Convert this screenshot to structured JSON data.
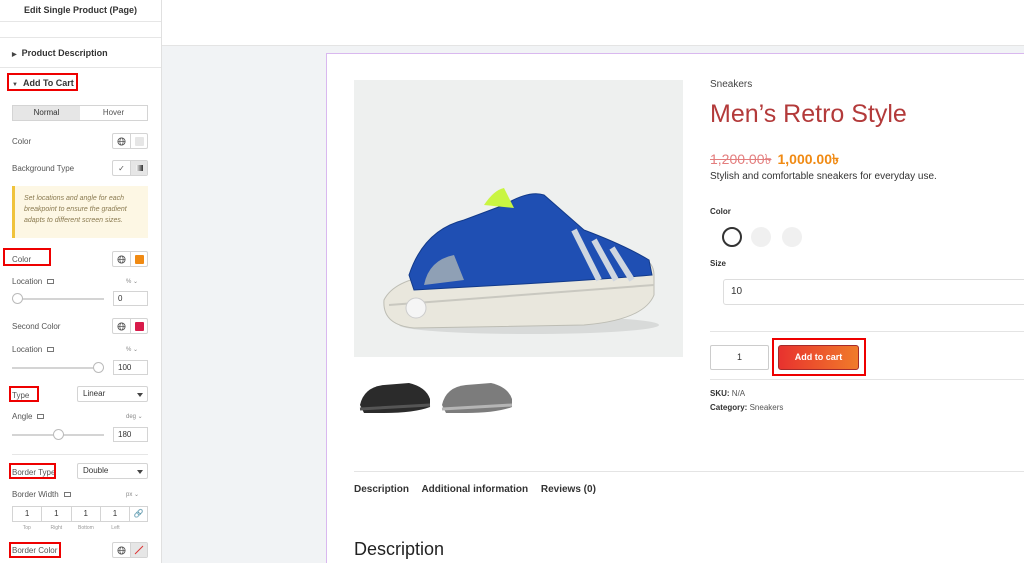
{
  "panel": {
    "title": "Edit Single Product (Page)",
    "sections": {
      "product_description": "Product Description",
      "add_to_cart": "Add To Cart"
    },
    "tabs": [
      "Normal",
      "Hover"
    ],
    "color_label": "Color",
    "background_type_label": "Background Type",
    "notice": "Set locations and angle for each breakpoint to ensure the gradient adapts to different screen sizes.",
    "gradient": {
      "color_label": "Color",
      "color_value": "#f08a13",
      "location_label": "Location",
      "location_unit": "% ⌄",
      "location_value": "0",
      "location_fraction": 0,
      "second_color_label": "Second Color",
      "second_color_value": "#d81b4a",
      "second_location_label": "Location",
      "second_location_unit": "% ⌄",
      "second_location_value": "100",
      "second_location_fraction": 1,
      "type_label": "Type",
      "type_value": "Linear",
      "angle_label": "Angle",
      "angle_unit": "deg ⌄",
      "angle_value": "180",
      "angle_fraction": 0.5
    },
    "border": {
      "type_label": "Border Type",
      "type_value": "Double",
      "width_label": "Border Width",
      "width_unit": "px ⌄",
      "width_values": [
        "1",
        "1",
        "1",
        "1"
      ],
      "width_sides": [
        "Top",
        "Right",
        "Bottom",
        "Left"
      ],
      "color_label": "Border Color"
    }
  },
  "product": {
    "category": "Sneakers",
    "title": "Men’s Retro Style",
    "old_price": "1,200.00৳",
    "new_price": "1,000.00৳",
    "description": "Stylish and comfortable sneakers for everyday use.",
    "color_label": "Color",
    "size_label": "Size",
    "size_value": "10",
    "quantity": "1",
    "add_to_cart": "Add to cart",
    "sku_label": "SKU:",
    "sku_value": "N/A",
    "category_label": "Category:",
    "category_value": "Sneakers",
    "tabs": [
      "Description",
      "Additional information",
      "Reviews (0)"
    ],
    "description_heading": "Description"
  },
  "colors": {
    "price_new": "#f08a13",
    "title": "#b33a3a",
    "highlight": "#ee0000"
  }
}
